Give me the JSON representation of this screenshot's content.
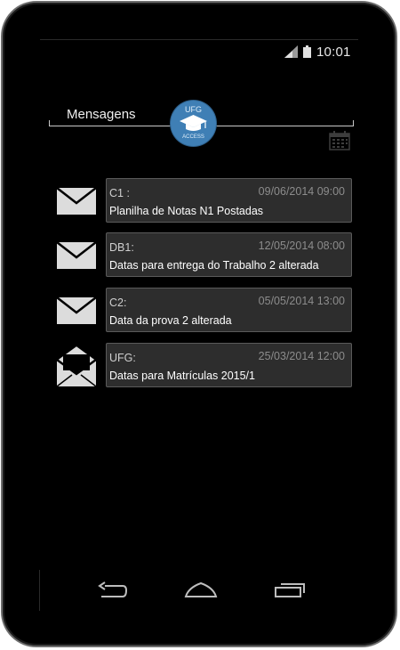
{
  "status_bar": {
    "time": "10:01",
    "icons": [
      "signal-icon",
      "battery-icon"
    ]
  },
  "header": {
    "title": "Mensagens",
    "logo_text_top": "UFG",
    "logo_text_bottom": "ACCESS",
    "actions": [
      "calendar-icon"
    ]
  },
  "messages": [
    {
      "sender": "C1 :",
      "time": "09/06/2014 09:00",
      "subject": "Planilha de Notas N1 Postadas",
      "icon": "envelope-closed-icon"
    },
    {
      "sender": "DB1:",
      "time": "12/05/2014 08:00",
      "subject": "Datas para entrega do Trabalho 2 alterada",
      "icon": "envelope-closed-icon"
    },
    {
      "sender": "C2:",
      "time": "05/05/2014 13:00",
      "subject": "Data da prova 2 alterada",
      "icon": "envelope-closed-icon"
    },
    {
      "sender": "UFG:",
      "time": "25/03/2014 12:00",
      "subject": "Datas para Matrículas 2015/1",
      "icon": "envelope-open-icon"
    }
  ],
  "nav_bar": [
    "back-icon",
    "home-icon",
    "recents-icon"
  ],
  "colors": {
    "background": "#000000",
    "card": "#2d2d2d",
    "card_border": "#5a5a5a",
    "logo": "#3f7fb5",
    "time_text": "#8c8c8c"
  }
}
